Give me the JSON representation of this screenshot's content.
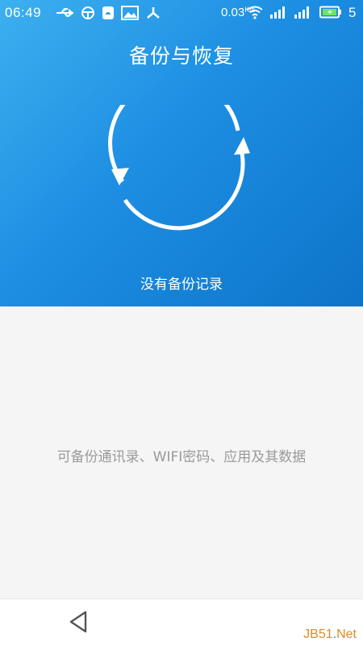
{
  "status_bar": {
    "time": "06:49",
    "speed": "0.03",
    "speed_unit": "K/s",
    "battery_label": "5",
    "icons": [
      "usb-icon",
      "steering-icon",
      "notification-icon",
      "image-icon",
      "share-icon",
      "wifi-icon",
      "signal-icon",
      "signal-icon",
      "battery-charging-icon"
    ]
  },
  "header": {
    "title": "备份与恢复",
    "subtitle": "没有备份记录",
    "icon": "sync-icon"
  },
  "main": {
    "hint": "可备份通讯录、WIFI密码、应用及其数据"
  },
  "nav": {
    "back_icon": "back-triangle-icon"
  },
  "watermark": {
    "brand": "JB51",
    "sep": ".",
    "tld": "Net"
  },
  "colors": {
    "hero_start": "#3cb0f0",
    "hero_end": "#0d74c9",
    "hint_text": "#9a9a9a"
  }
}
